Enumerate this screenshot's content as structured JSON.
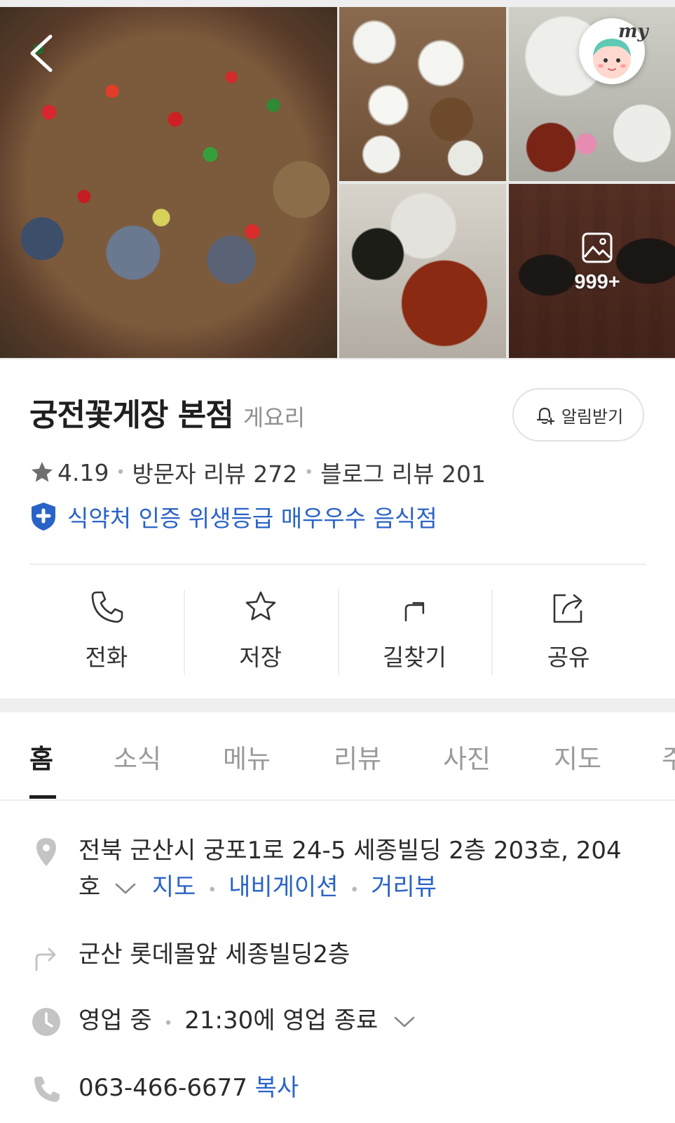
{
  "header": {
    "photo_count": "999+",
    "my_label": "my"
  },
  "place": {
    "name": "궁전꽃게장 본점",
    "category": "게요리",
    "notify_label": "알림받기",
    "rating": "4.19",
    "visitor_review": "방문자 리뷰 272",
    "blog_review": "블로그 리뷰 201",
    "certification": "식약처 인증 위생등급 매우우수 음식점"
  },
  "actions": [
    {
      "label": "전화",
      "icon": "phone-icon"
    },
    {
      "label": "저장",
      "icon": "star-icon"
    },
    {
      "label": "길찾기",
      "icon": "directions-icon"
    },
    {
      "label": "공유",
      "icon": "share-icon"
    }
  ],
  "tabs": [
    {
      "label": "홈",
      "active": true
    },
    {
      "label": "소식"
    },
    {
      "label": "메뉴"
    },
    {
      "label": "리뷰"
    },
    {
      "label": "사진"
    },
    {
      "label": "지도"
    },
    {
      "label": "주"
    }
  ],
  "info": {
    "address_line1": "전북 군산시 궁포1로 24-5 세종빌딩 2층 203호, 204",
    "address_line2": "호",
    "map_link": "지도",
    "navigation_link": "내비게이션",
    "streetview_link": "거리뷰",
    "directions_text": "군산 롯데몰앞 세종빌딩2층",
    "status": "영업 중",
    "hours": "21:30에 영업 종료",
    "phone": "063-466-6677",
    "copy_label": "복사"
  },
  "colors": {
    "link": "#2a63c7",
    "icon_gray": "#c4c4c4",
    "text": "#2a2a2a"
  }
}
